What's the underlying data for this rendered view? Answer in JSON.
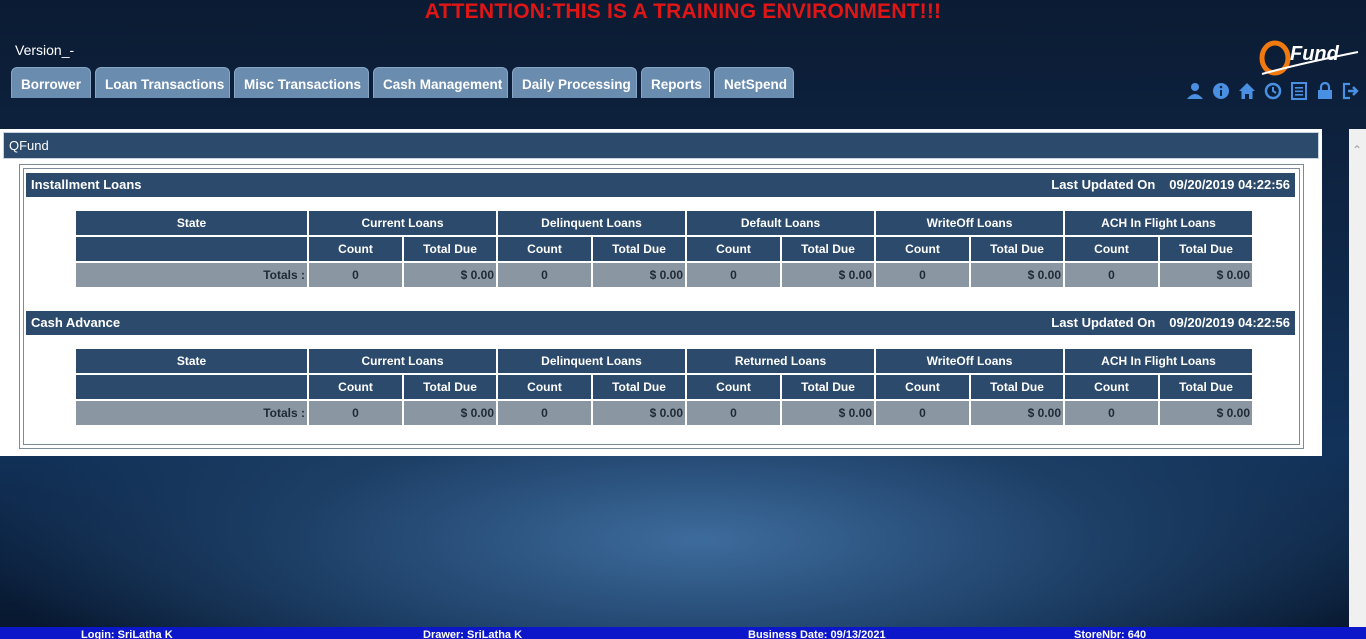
{
  "banner": "ATTENTION:THIS IS A TRAINING ENVIRONMENT!!!",
  "version": "Version_-",
  "tabs": [
    "Borrower",
    "Loan Transactions",
    "Misc Transactions",
    "Cash Management",
    "Daily Processing",
    "Reports",
    "NetSpend"
  ],
  "logo": {
    "text": "Fund",
    "accent": "#f07a10"
  },
  "toolbar_icons": [
    "user-icon",
    "info-icon",
    "home-icon",
    "clock-icon",
    "list-icon",
    "lock-icon",
    "logout-icon"
  ],
  "panel_title": "QFund",
  "sections": [
    {
      "title": "Installment Loans",
      "updated_label": "Last Updated On",
      "updated_value": "09/20/2019 04:22:56",
      "columns": [
        "State",
        "Current Loans",
        "Delinquent Loans",
        "Default Loans",
        "WriteOff Loans",
        "ACH In Flight Loans"
      ],
      "subheaders": [
        "Count",
        "Total Due"
      ],
      "totals_label": "Totals :",
      "totals": [
        "0",
        "$ 0.00",
        "0",
        "$ 0.00",
        "0",
        "$ 0.00",
        "0",
        "$ 0.00",
        "0",
        "$ 0.00"
      ]
    },
    {
      "title": "Cash Advance",
      "updated_label": "Last Updated On",
      "updated_value": "09/20/2019 04:22:56",
      "columns": [
        "State",
        "Current Loans",
        "Delinquent Loans",
        "Returned Loans",
        "WriteOff Loans",
        "ACH In Flight Loans"
      ],
      "subheaders": [
        "Count",
        "Total Due"
      ],
      "totals_label": "Totals :",
      "totals": [
        "0",
        "$ 0.00",
        "0",
        "$ 0.00",
        "0",
        "$ 0.00",
        "0",
        "$ 0.00",
        "0",
        "$ 0.00"
      ]
    }
  ],
  "status": {
    "login": "Login: SriLatha K",
    "drawer": "Drawer: SriLatha K",
    "business_date": "Business Date: 09/13/2021",
    "store": "StoreNbr: 640"
  },
  "colors": {
    "banner": "#e01616",
    "header": "#2c4a6b",
    "totals_row": "#8a96a2",
    "statusbar": "#0b17c8"
  }
}
